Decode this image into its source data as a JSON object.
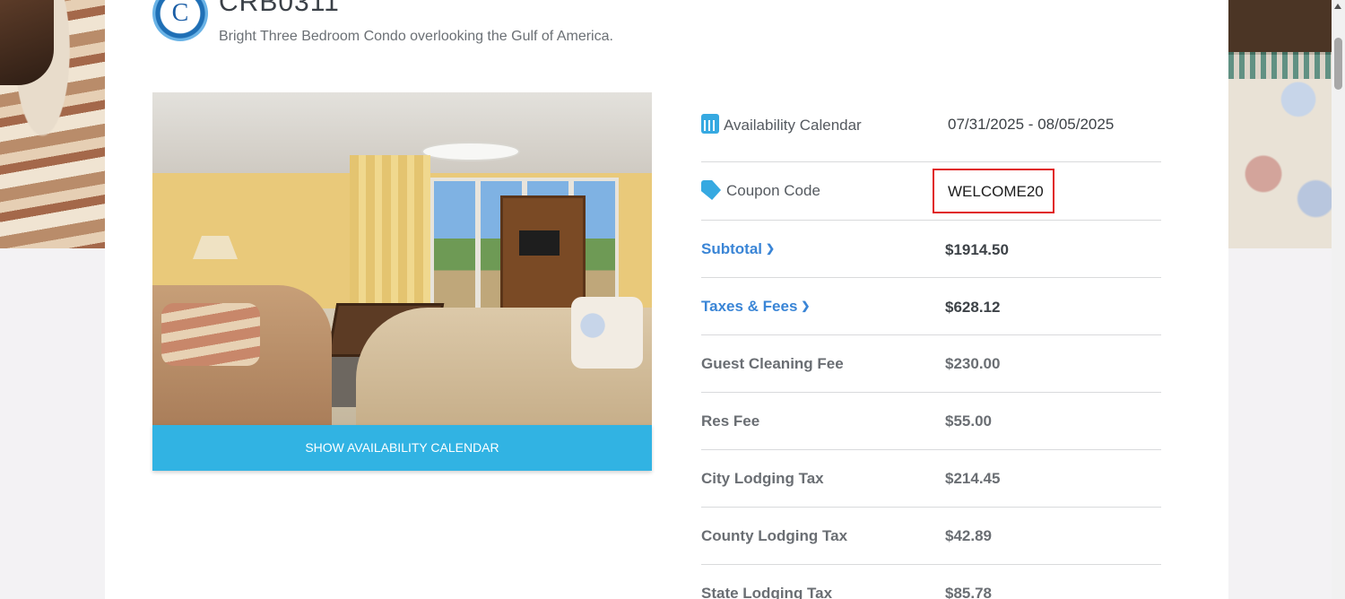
{
  "header": {
    "logo_letter": "C",
    "title": "CRB0311",
    "subtitle": "Bright Three Bedroom Condo overlooking the Gulf of America."
  },
  "gallery": {
    "button_label": "SHOW AVAILABILITY CALENDAR"
  },
  "quote": {
    "availability_label": "Availability Calendar",
    "availability_value": "07/31/2025 - 08/05/2025",
    "coupon_label": "Coupon Code",
    "coupon_value": "WELCOME20",
    "subtotal_label": "Subtotal",
    "subtotal_value": "$1914.50",
    "taxes_label": "Taxes & Fees",
    "taxes_value": "$628.12",
    "items": [
      {
        "label": "Guest Cleaning Fee",
        "value": "$230.00"
      },
      {
        "label": "Res Fee",
        "value": "$55.00"
      },
      {
        "label": "City Lodging Tax",
        "value": "$214.45"
      },
      {
        "label": "County Lodging Tax",
        "value": "$42.89"
      },
      {
        "label": "State Lodging Tax",
        "value": "$85.78"
      }
    ]
  },
  "colors": {
    "accent": "#31b3e3",
    "link": "#3a85d6",
    "highlight_border": "#e01f1f"
  }
}
